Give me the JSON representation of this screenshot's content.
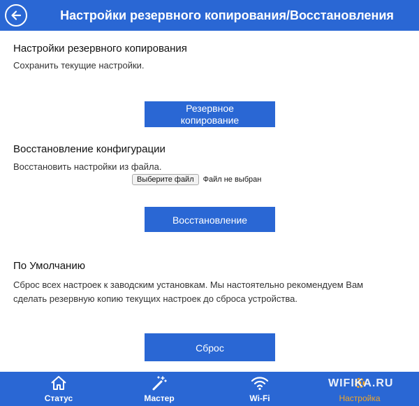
{
  "header": {
    "title": "Настройки резервного копирования/Восстановления"
  },
  "backup": {
    "title": "Настройки резервного копирования",
    "desc": "Сохранить текущие настройки.",
    "button_line1": "Резервное",
    "button_line2": "копирование"
  },
  "restore": {
    "title": "Восстановление конфигурации",
    "desc": "Восстановить настройки из файла.",
    "file_button": "Выберите файл",
    "file_status": "Файл не выбран",
    "button": "Восстановление"
  },
  "defaults": {
    "title": "По Умолчанию",
    "desc_line1": "Сброс всех настроек к заводским установкам. Мы настоятельно рекомендуем Вам",
    "desc_line2": "сделать резервную копию текущих настроек до сброса устройства.",
    "button": "Сброс"
  },
  "nav": {
    "items": [
      {
        "label": "Статус",
        "icon": "home-icon"
      },
      {
        "label": "Мастер",
        "icon": "magic-wand-icon"
      },
      {
        "label": "Wi-Fi",
        "icon": "wifi-icon"
      },
      {
        "label": "Настройка",
        "icon": "gear-icon",
        "active": true
      }
    ],
    "active_color": "#f5a623"
  },
  "watermark": {
    "text": "WIFIKA.RU"
  },
  "colors": {
    "primary": "#2a67d4"
  }
}
